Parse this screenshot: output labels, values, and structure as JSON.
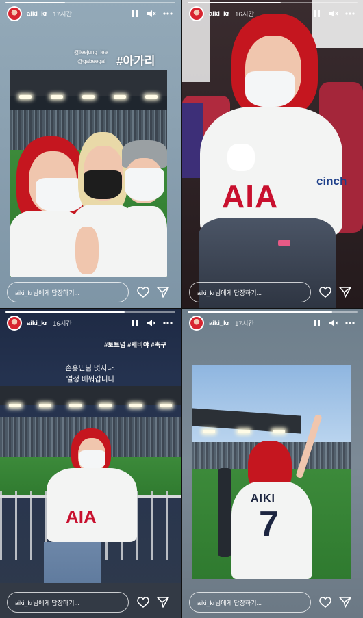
{
  "colors": {
    "accent_hair": "#c5161f",
    "shirt": "#f3f4f3",
    "ui_text": "#ffffff"
  },
  "stories": [
    {
      "username": "aiki_kr",
      "time": "17시간",
      "progress": 0.35,
      "overlay": {
        "mentions": [
          "@leejung_lee",
          "@gabeegal"
        ],
        "hashtag": "#아가리"
      },
      "reply_placeholder": "aiki_kr님에게 답장하기..."
    },
    {
      "username": "aiki_kr",
      "time": "16시간",
      "progress": 0.55,
      "shirt_text": {
        "sponsor": "AIA",
        "sponsor2": "cinch"
      },
      "reply_placeholder": "aiki_kr님에게 답장하기..."
    },
    {
      "username": "aiki_kr",
      "time": "16시간",
      "progress": 0.7,
      "overlay": {
        "hashtags": "#토트넘 #세비야 #축구",
        "caption_line1": "손흥민님 멋지다.",
        "caption_line2": "열정 배워갑니다"
      },
      "shirt_text": {
        "sponsor": "AIA"
      },
      "reply_placeholder": "aiki_kr님에게 답장하기..."
    },
    {
      "username": "aiki_kr",
      "time": "17시간",
      "progress": 0.85,
      "shirt_text": {
        "name": "AIKI",
        "number": "7"
      },
      "reply_placeholder": "aiki_kr님에게 답장하기..."
    }
  ],
  "icons": [
    "avatar",
    "pause-icon",
    "mute-icon",
    "more-icon",
    "heart-icon",
    "send-icon"
  ]
}
